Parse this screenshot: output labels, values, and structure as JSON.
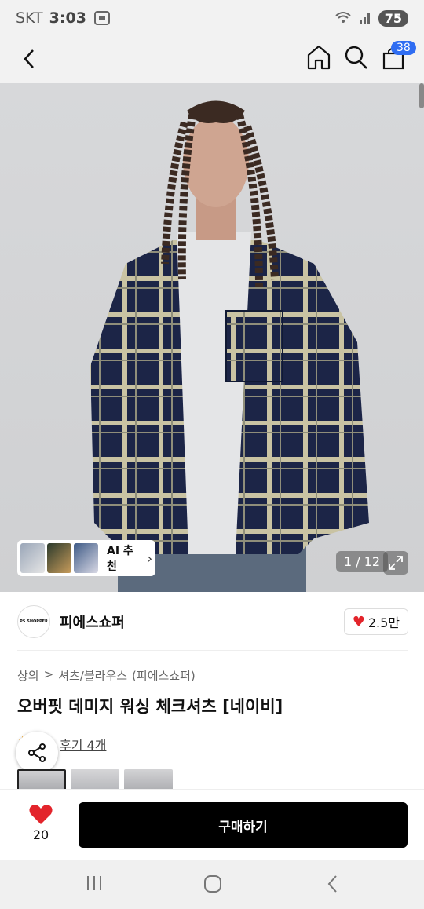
{
  "status": {
    "carrier": "SKT",
    "time": "3:03",
    "battery": "75"
  },
  "header": {
    "cart_count": "38"
  },
  "gallery": {
    "counter": "1 / 12",
    "ai_label": "AI 추천"
  },
  "brand": {
    "name": "피에스쇼퍼",
    "logo_text": "PS.SHOPPER",
    "likes": "2.5만"
  },
  "breadcrumb": [
    "상의",
    ">",
    "셔츠/블라우스",
    "(피에스쇼퍼)"
  ],
  "product": {
    "title": "오버핏 데미지 워싱 체크셔츠 [네이비]",
    "review_label": "후기 4개"
  },
  "bottom": {
    "wish_count": "20",
    "buy_label": "구매하기"
  },
  "colors": {
    "accent": "#2f6df2",
    "heart": "#e3242b",
    "buy_bg": "#000000"
  }
}
